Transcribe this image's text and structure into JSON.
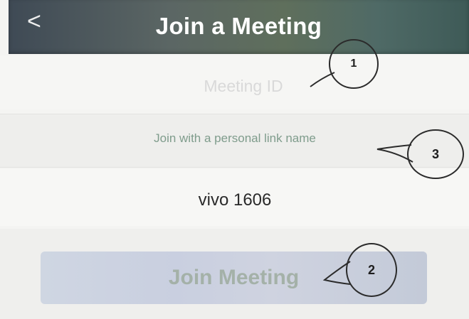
{
  "header": {
    "back_icon": "chevron-left-icon",
    "back_glyph": "<",
    "title": "Join a Meeting"
  },
  "meeting_id": {
    "placeholder": "Meeting ID",
    "value": ""
  },
  "personal_link": {
    "label": "Join with a personal link name"
  },
  "device": {
    "name": "vivo 1606"
  },
  "join_button": {
    "label": "Join Meeting"
  },
  "annotations": {
    "one": "1",
    "two": "2",
    "three": "3"
  },
  "colors": {
    "header": "#5b6664",
    "link": "#7f9c8c",
    "button": "#c9cfe0",
    "button_text": "#a4b1a8"
  }
}
